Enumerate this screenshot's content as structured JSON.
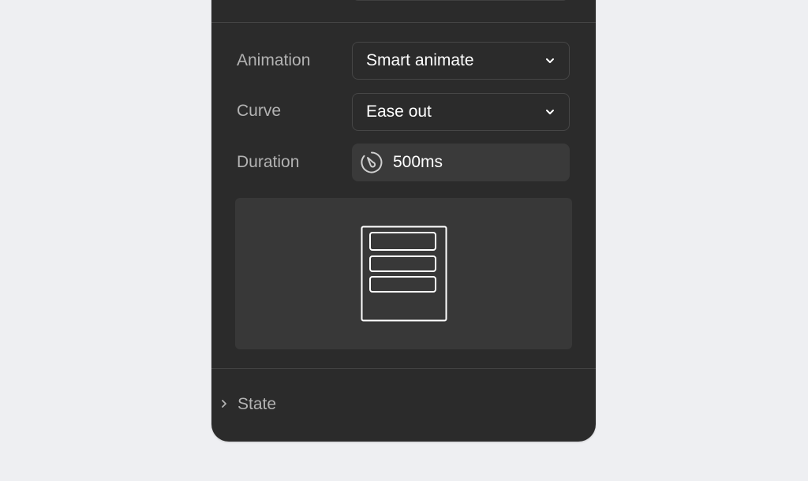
{
  "transition": {
    "animation": {
      "label": "Animation",
      "value": "Smart animate"
    },
    "curve": {
      "label": "Curve",
      "value": "Ease out"
    },
    "duration": {
      "label": "Duration",
      "value": "500ms",
      "icon": "dial-icon"
    }
  },
  "preview": {
    "icon": "device-list-preview-icon"
  },
  "state_section": {
    "label": "State",
    "icon": "chevron-right-icon"
  },
  "colors": {
    "page_background": "#eeeff2",
    "panel_background": "#2b2b2b",
    "field_background": "#3a3a3a",
    "preview_background": "#383838",
    "label_text": "#b3b3b3",
    "value_text": "#ffffff"
  }
}
